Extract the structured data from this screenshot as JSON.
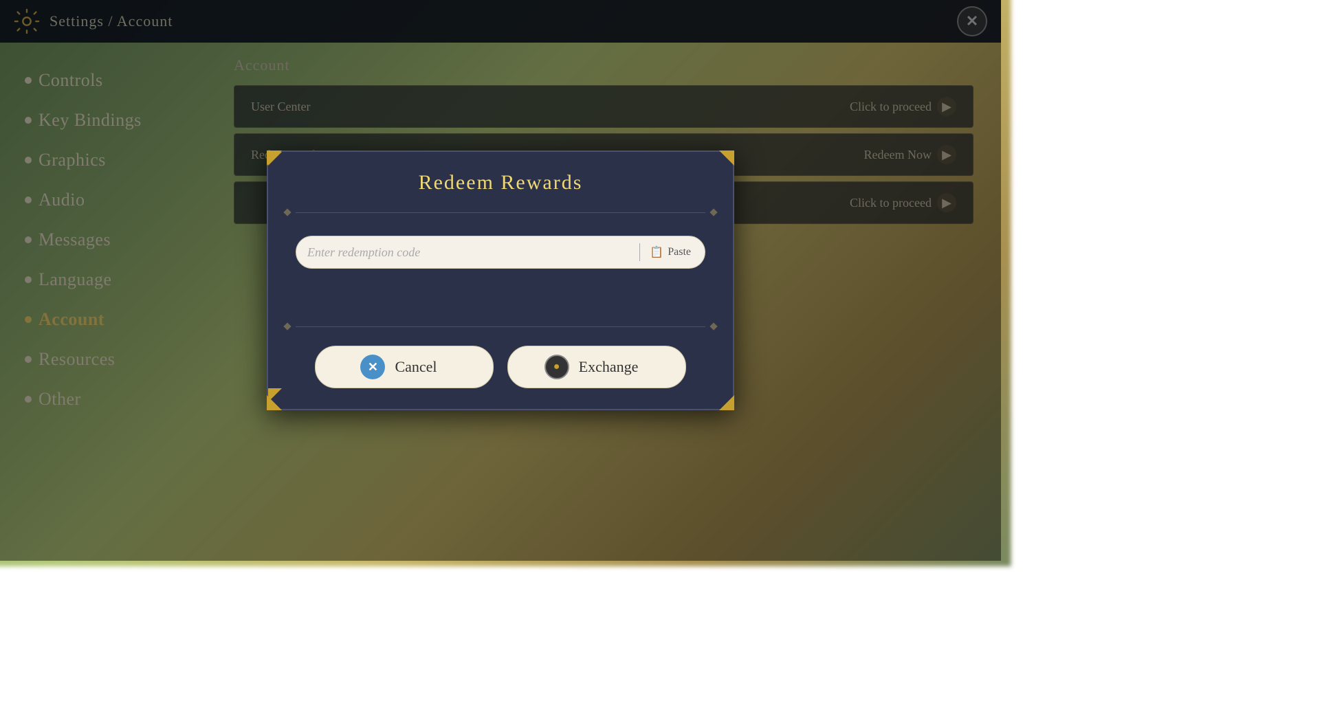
{
  "topbar": {
    "title": "Settings / Account",
    "close_label": "✕"
  },
  "sidebar": {
    "items": [
      {
        "id": "controls",
        "label": "Controls",
        "active": false
      },
      {
        "id": "key-bindings",
        "label": "Key Bindings",
        "active": false
      },
      {
        "id": "graphics",
        "label": "Graphics",
        "active": false
      },
      {
        "id": "audio",
        "label": "Audio",
        "active": false
      },
      {
        "id": "messages",
        "label": "Messages",
        "active": false
      },
      {
        "id": "language",
        "label": "Language",
        "active": false
      },
      {
        "id": "account",
        "label": "Account",
        "active": true
      },
      {
        "id": "resources",
        "label": "Resources",
        "active": false
      },
      {
        "id": "other",
        "label": "Other",
        "active": false
      }
    ]
  },
  "main": {
    "section_title": "Account",
    "rows": [
      {
        "id": "user-center",
        "label": "User Center",
        "action": "Click to proceed"
      },
      {
        "id": "redeem-code",
        "label": "Redeem Code",
        "action": "Redeem Now"
      },
      {
        "id": "third-row",
        "label": "",
        "action": "Click to proceed"
      }
    ]
  },
  "modal": {
    "title": "Redeem Rewards",
    "input_placeholder": "Enter redemption code",
    "paste_label": "Paste",
    "cancel_label": "Cancel",
    "exchange_label": "Exchange",
    "cancel_icon": "✕",
    "exchange_icon": "●"
  }
}
